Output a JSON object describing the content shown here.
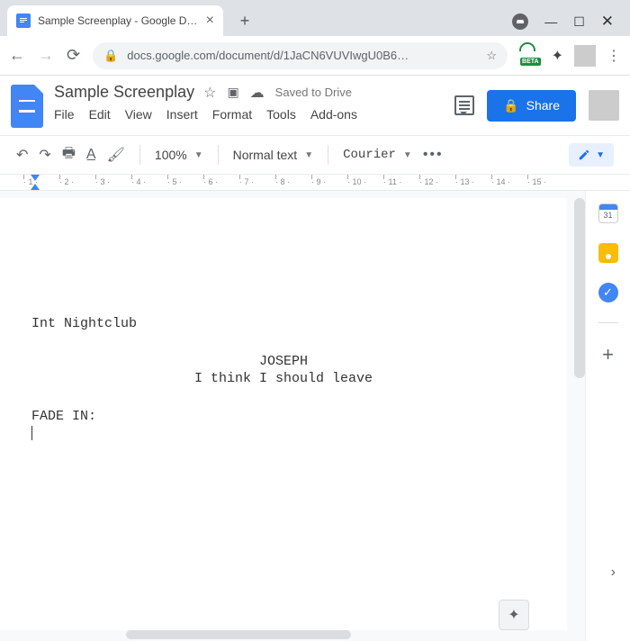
{
  "browser": {
    "tab_title": "Sample Screenplay - Google Docs",
    "url_display": "docs.google.com/document/d/1JaCN6VUVIwgU0B6…",
    "beta_label": "BETA"
  },
  "docs": {
    "title": "Sample Screenplay",
    "saved_status": "Saved to Drive",
    "menus": [
      "File",
      "Edit",
      "View",
      "Insert",
      "Format",
      "Tools",
      "Add-ons"
    ],
    "share_label": "Share",
    "zoom": "100%",
    "style": "Normal text",
    "font": "Courier",
    "calendar_day": "31"
  },
  "document": {
    "scene_heading": "Int Nightclub",
    "character": "JOSEPH",
    "dialogue": "I think I should leave",
    "transition": "FADE IN:"
  },
  "ruler": {
    "marks": [
      "1",
      "2",
      "3",
      "4",
      "5",
      "6",
      "7",
      "8",
      "9",
      "10",
      "11",
      "12",
      "13",
      "14",
      "15"
    ]
  }
}
